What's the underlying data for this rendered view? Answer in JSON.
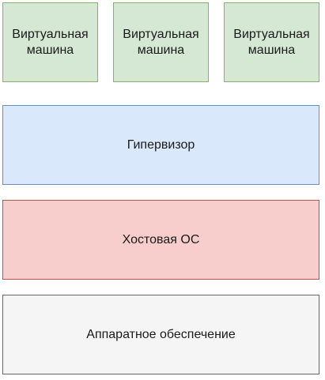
{
  "virtual_machines": [
    {
      "label": "Виртуальная машина"
    },
    {
      "label": "Виртуальная машина"
    },
    {
      "label": "Виртуальная машина"
    }
  ],
  "layers": {
    "hypervisor": "Гипервизор",
    "host_os": "Хостовая ОС",
    "hardware": "Аппаратное обеспечение"
  },
  "colors": {
    "vm_fill": "#d5e8d4",
    "vm_border": "#82b366",
    "hypervisor_fill": "#dae8fc",
    "hypervisor_border": "#6c8ebf",
    "host_os_fill": "#f8cecc",
    "host_os_border": "#b85450",
    "hardware_fill": "#f5f5f5",
    "hardware_border": "#666666"
  }
}
